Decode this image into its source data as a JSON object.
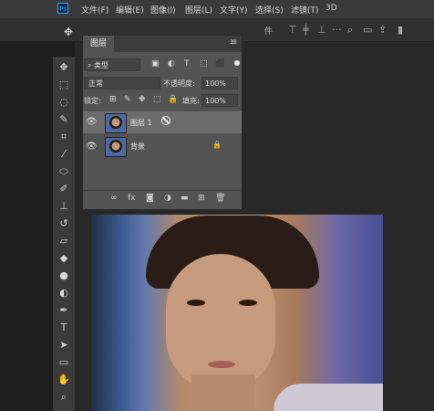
{
  "app": {
    "logo_text": "Ps"
  },
  "menubar": {
    "items": [
      "文件(F)",
      "编辑(E)",
      "图像(I)",
      "图层(L)",
      "文字(Y)",
      "选择(S)",
      "滤镜(T)",
      "3D"
    ]
  },
  "optionsbar": {
    "move_tool_glyph": "✥",
    "partial_label": "件"
  },
  "toolbar": {
    "tools": [
      {
        "name": "move-tool-icon",
        "glyph": "✥"
      },
      {
        "name": "marquee-tool-icon",
        "glyph": "⬚"
      },
      {
        "name": "lasso-tool-icon",
        "glyph": "◌"
      },
      {
        "name": "quick-select-tool-icon",
        "glyph": "✎"
      },
      {
        "name": "crop-tool-icon",
        "glyph": "⌗"
      },
      {
        "name": "eyedropper-tool-icon",
        "glyph": "⁄"
      },
      {
        "name": "healing-tool-icon",
        "glyph": "⬭"
      },
      {
        "name": "brush-tool-icon",
        "glyph": "✐"
      },
      {
        "name": "stamp-tool-icon",
        "glyph": "⊥"
      },
      {
        "name": "history-brush-tool-icon",
        "glyph": "↺"
      },
      {
        "name": "eraser-tool-icon",
        "glyph": "▱"
      },
      {
        "name": "gradient-tool-icon",
        "glyph": "◆"
      },
      {
        "name": "blur-tool-icon",
        "glyph": "●"
      },
      {
        "name": "dodge-tool-icon",
        "glyph": "◐"
      },
      {
        "name": "pen-tool-icon",
        "glyph": "✒"
      },
      {
        "name": "type-tool-icon",
        "glyph": "T"
      },
      {
        "name": "path-select-tool-icon",
        "glyph": "➤"
      },
      {
        "name": "rectangle-tool-icon",
        "glyph": "▭"
      },
      {
        "name": "hand-tool-icon",
        "glyph": "✋"
      },
      {
        "name": "zoom-tool-icon",
        "glyph": "⌕"
      }
    ]
  },
  "layers_panel": {
    "tab_label": "图层",
    "menu_glyph": "≡",
    "filter": {
      "value": "⌕ 类型",
      "icons": [
        "▣",
        "◐",
        "T",
        "⬚",
        "⬛"
      ]
    },
    "blend_mode": "正常",
    "opacity_label": "不透明度:",
    "opacity_value": "100%",
    "lock_label": "锁定:",
    "lock_icons": [
      "⊞",
      "✎",
      "✥",
      "⬚",
      "🔒"
    ],
    "fill_label": "填充:",
    "fill_value": "100%",
    "layers": [
      {
        "name": "图层 1",
        "visible": true,
        "selected": true
      },
      {
        "name": "背景",
        "visible": true,
        "locked": true
      }
    ],
    "bottom_icons": [
      "∞",
      "fx",
      "◙",
      "◑",
      "▬",
      "⊞",
      "🗑"
    ]
  }
}
